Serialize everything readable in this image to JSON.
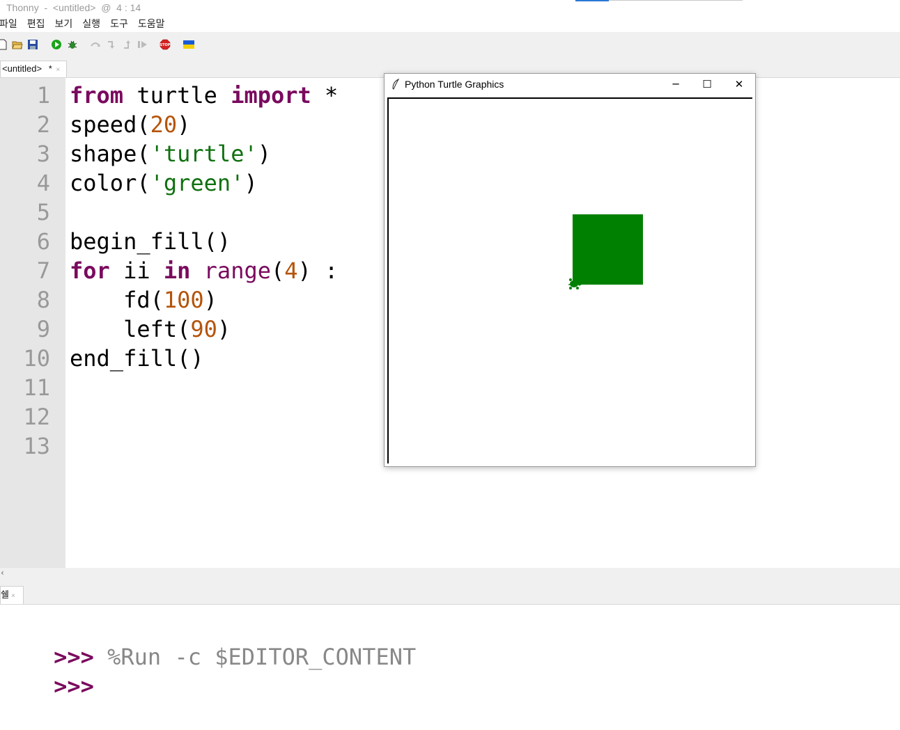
{
  "window": {
    "title": "Thonny  -  <untitled>  @  4 : 14"
  },
  "menu": [
    "파일",
    "편집",
    "보기",
    "실행",
    "도구",
    "도움말"
  ],
  "toolbar": {
    "icons": [
      "new-file-icon",
      "open-file-icon",
      "save-file-icon",
      "run-icon",
      "debug-icon",
      "step-over-icon",
      "step-into-icon",
      "step-out-icon",
      "resume-icon",
      "stop-icon",
      "ukraine-flag-icon"
    ],
    "stop_label": "STOP",
    "colors": {
      "run": "#1aa31a",
      "stop": "#d62020",
      "flag_blue": "#1a5bd6",
      "flag_yellow": "#f5d000"
    }
  },
  "editor_tab": {
    "label": "<untitled>",
    "modified": "*",
    "close": "×"
  },
  "editor": {
    "line_numbers": [
      "1",
      "2",
      "3",
      "4",
      "5",
      "6",
      "7",
      "8",
      "9",
      "10",
      "11",
      "12",
      "13"
    ],
    "lines": [
      [
        {
          "t": "from",
          "c": "kw"
        },
        {
          "t": " turtle ",
          "c": ""
        },
        {
          "t": "import",
          "c": "kw"
        },
        {
          "t": " *",
          "c": ""
        }
      ],
      [
        {
          "t": "speed(",
          "c": ""
        },
        {
          "t": "20",
          "c": "num"
        },
        {
          "t": ")",
          "c": ""
        }
      ],
      [
        {
          "t": "shape(",
          "c": ""
        },
        {
          "t": "'turtle'",
          "c": "str"
        },
        {
          "t": ")",
          "c": ""
        }
      ],
      [
        {
          "t": "color(",
          "c": ""
        },
        {
          "t": "'green'",
          "c": "str"
        },
        {
          "t": ")",
          "c": ""
        }
      ],
      [],
      [
        {
          "t": "begin_fill()",
          "c": ""
        }
      ],
      [
        {
          "t": "for",
          "c": "kw"
        },
        {
          "t": " ii ",
          "c": ""
        },
        {
          "t": "in",
          "c": "kw"
        },
        {
          "t": " ",
          "c": ""
        },
        {
          "t": "range",
          "c": "bi"
        },
        {
          "t": "(",
          "c": ""
        },
        {
          "t": "4",
          "c": "num"
        },
        {
          "t": ") :",
          "c": ""
        }
      ],
      [
        {
          "t": "    fd(",
          "c": ""
        },
        {
          "t": "100",
          "c": "num"
        },
        {
          "t": ")",
          "c": ""
        }
      ],
      [
        {
          "t": "    left(",
          "c": ""
        },
        {
          "t": "90",
          "c": "num"
        },
        {
          "t": ")",
          "c": ""
        }
      ],
      [
        {
          "t": "end_fill()",
          "c": ""
        }
      ],
      [],
      [],
      []
    ]
  },
  "shell_tab": {
    "label": "쉘",
    "close": "×"
  },
  "shell": {
    "prompt": ">>>",
    "lines": [
      {
        "prompt": ">>>",
        "text": " %Run -c $EDITOR_CONTENT"
      },
      {
        "prompt": ">>>",
        "text": ""
      }
    ]
  },
  "turtle_window": {
    "title": "Python Turtle Graphics",
    "icon": "feather-icon",
    "buttons": {
      "minimize": "─",
      "maximize": "☐",
      "close": "✕"
    },
    "fill_color": "#008000"
  }
}
